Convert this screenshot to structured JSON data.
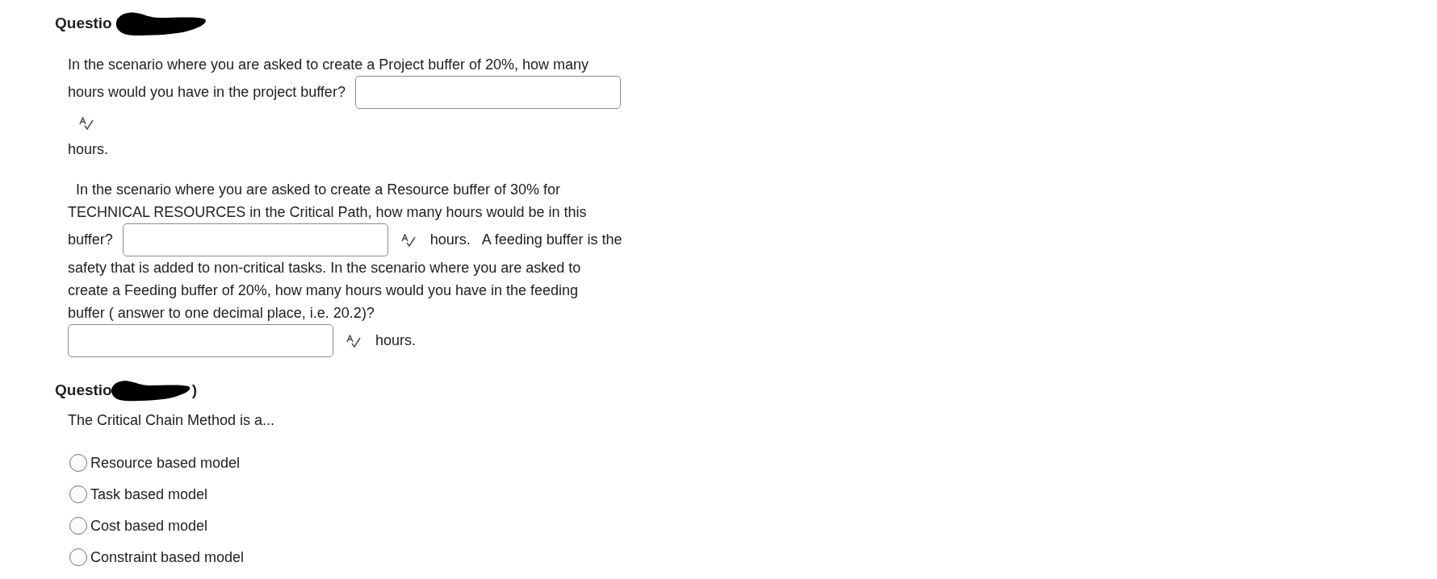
{
  "questions": [
    {
      "heading": "Questio",
      "redacted": true,
      "lines": [
        {
          "items": [
            {
              "kind": "text",
              "text": "In the scenario where you are asked to create a Project buffer of 20%, how many"
            }
          ]
        },
        {
          "items": [
            {
              "kind": "text",
              "text": "hours would you have in the project buffer?"
            },
            {
              "kind": "input"
            }
          ]
        },
        {
          "items": [
            {
              "kind": "check"
            }
          ]
        },
        {
          "items": [
            {
              "kind": "text",
              "text": "hours."
            }
          ]
        },
        {
          "new_paragraph": true,
          "items": [
            {
              "kind": "text",
              "text": "  In the scenario where you are asked to create a Resource buffer of 30% for"
            }
          ]
        },
        {
          "items": [
            {
              "kind": "text",
              "text": "TECHNICAL RESOURCES in the Critical Path, how many hours would be in this"
            }
          ]
        },
        {
          "items": [
            {
              "kind": "text",
              "text": "buffer?"
            },
            {
              "kind": "input"
            },
            {
              "kind": "check"
            },
            {
              "kind": "text",
              "text": "hours.   A feeding buffer is the"
            }
          ]
        },
        {
          "items": [
            {
              "kind": "text",
              "text": "safety that is added to non-critical tasks. In the scenario where you are asked to"
            }
          ]
        },
        {
          "items": [
            {
              "kind": "text",
              "text": "create a Feeding buffer of 20%, how many hours would you have in the feeding"
            }
          ]
        },
        {
          "items": [
            {
              "kind": "text",
              "text": "buffer ( answer to one decimal place, i.e. 20.2)?"
            }
          ]
        },
        {
          "items": [
            {
              "kind": "input"
            },
            {
              "kind": "check"
            },
            {
              "kind": "text",
              "text": "hours."
            }
          ]
        }
      ]
    },
    {
      "heading": "Questio",
      "heading_tail": ")",
      "redacted": true,
      "lines": [
        {
          "items": [
            {
              "kind": "text",
              "text": "The Critical Chain Method is a..."
            }
          ]
        }
      ],
      "options": [
        {
          "label": "Resource based model",
          "selected": false
        },
        {
          "label": "Task based model",
          "selected": false
        },
        {
          "label": "Cost based model",
          "selected": false
        },
        {
          "label": "Constraint based model",
          "selected": false
        }
      ]
    }
  ]
}
